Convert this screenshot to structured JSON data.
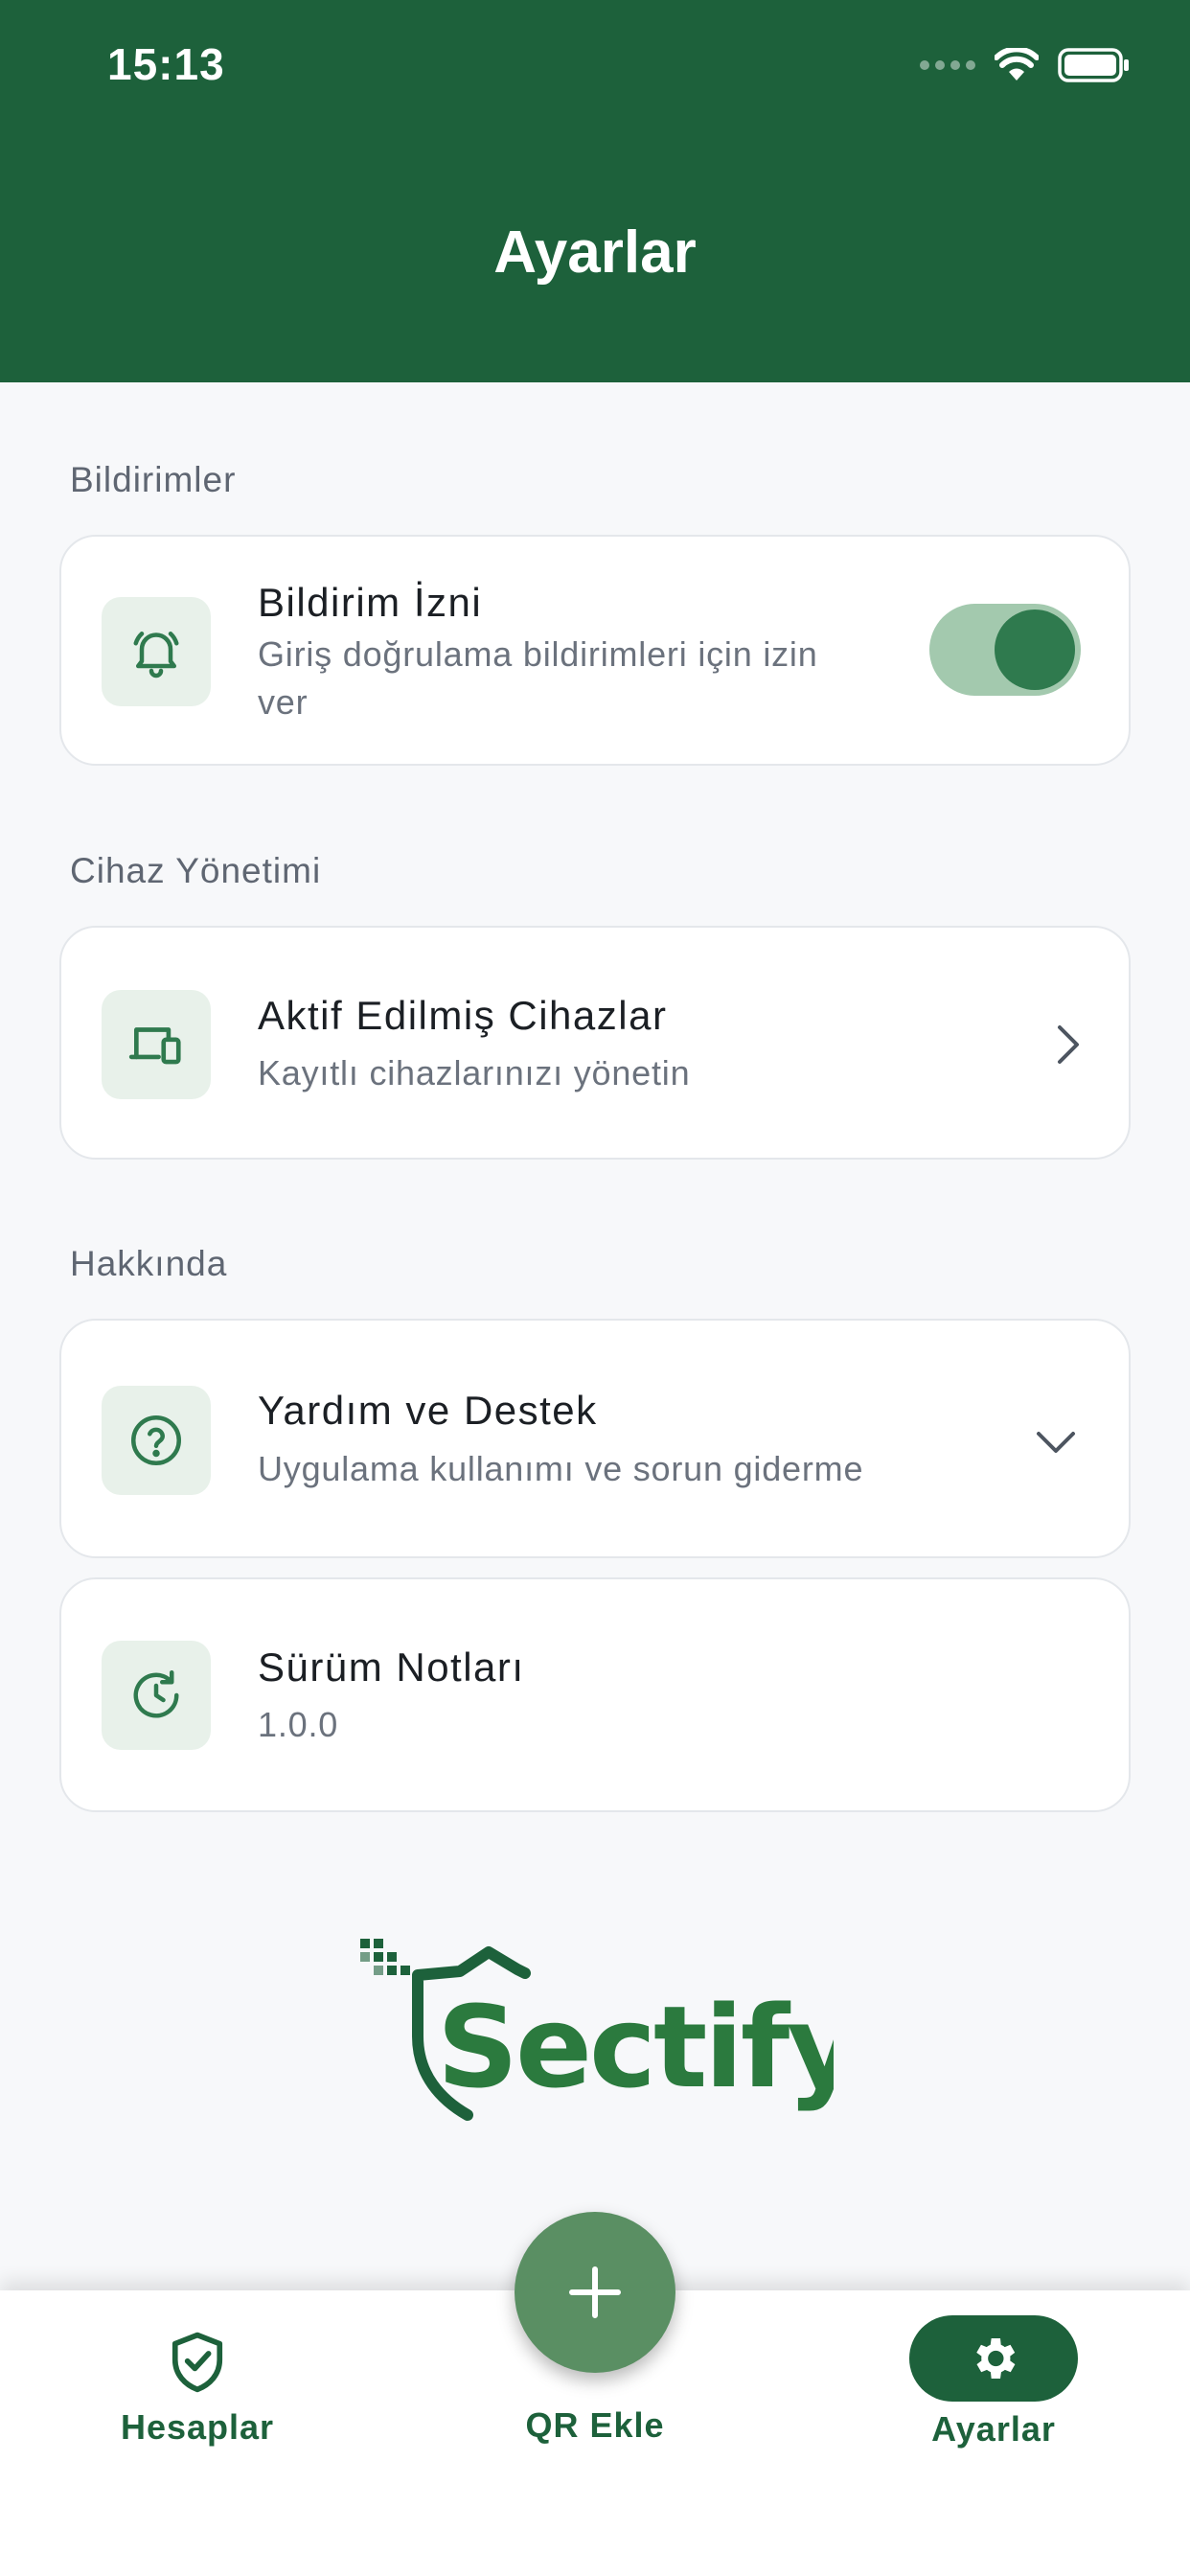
{
  "status_bar": {
    "time": "15:13"
  },
  "header": {
    "title": "Ayarlar"
  },
  "sections": {
    "notifications": {
      "label": "Bildirimler",
      "item": {
        "title": "Bildirim İzni",
        "subtitle_line1": "Giriş doğrulama bildirimleri için izin",
        "subtitle_line2": "ver",
        "toggle_on": true,
        "icon": "bell-icon"
      }
    },
    "device_management": {
      "label": "Cihaz Yönetimi",
      "item": {
        "title": "Aktif Edilmiş Cihazlar",
        "subtitle": "Kayıtlı cihazlarınızı yönetin",
        "icon": "devices-icon"
      }
    },
    "about": {
      "label": "Hakkında",
      "help": {
        "title": "Yardım ve Destek",
        "subtitle": "Uygulama kullanımı ve sorun giderme",
        "icon": "help-circle-icon"
      },
      "release_notes": {
        "title": "Sürüm Notları",
        "version": "1.0.0",
        "icon": "history-icon"
      }
    }
  },
  "logo": {
    "text": "Sectify"
  },
  "bottom_nav": {
    "accounts_label": "Hesaplar",
    "add_qr_label": "QR Ekle",
    "settings_label": "Ayarlar"
  },
  "colors": {
    "brand": "#1d613b",
    "fab": "#5a8f63",
    "icon_bg": "#e8f1ea",
    "background": "#f7f8fa"
  }
}
